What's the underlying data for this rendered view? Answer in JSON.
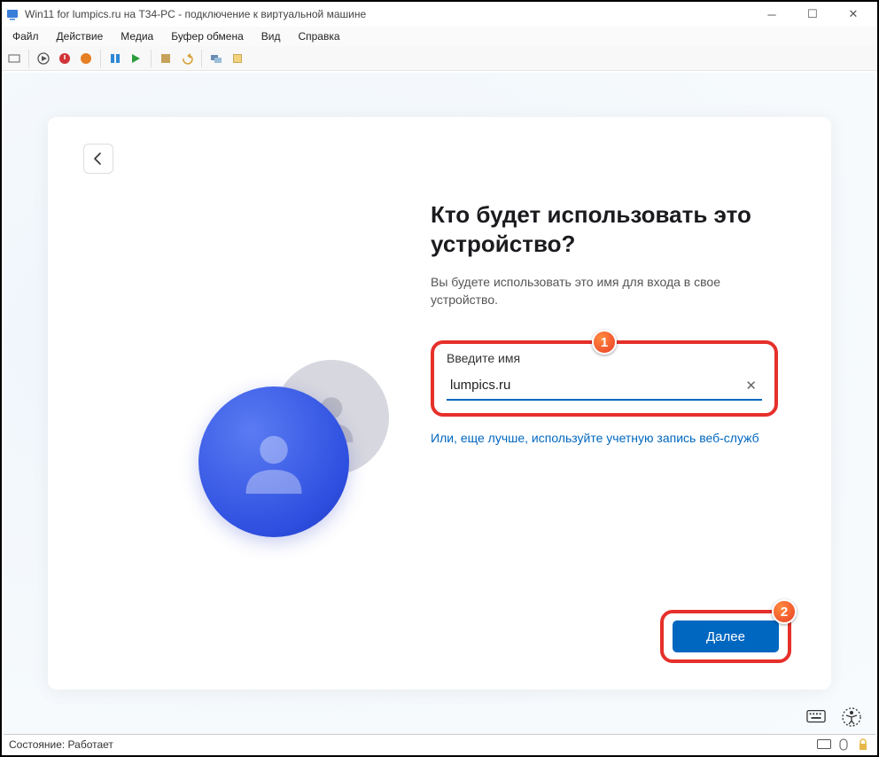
{
  "window": {
    "title": "Win11 for lumpics.ru на T34-PC - подключение к виртуальной машине"
  },
  "menu": {
    "file": "Файл",
    "action": "Действие",
    "media": "Медиа",
    "clipboard": "Буфер обмена",
    "view": "Вид",
    "help": "Справка"
  },
  "oobe": {
    "heading": "Кто будет использовать это устройство?",
    "subtext": "Вы будете использовать это имя для входа в свое устройство.",
    "field_label": "Введите имя",
    "name_value": "lumpics.ru",
    "link_text": "Или, еще лучше, используйте учетную запись веб-служб",
    "next_label": "Далее"
  },
  "badges": {
    "one": "1",
    "two": "2"
  },
  "statusbar": {
    "text": "Состояние: Работает"
  }
}
